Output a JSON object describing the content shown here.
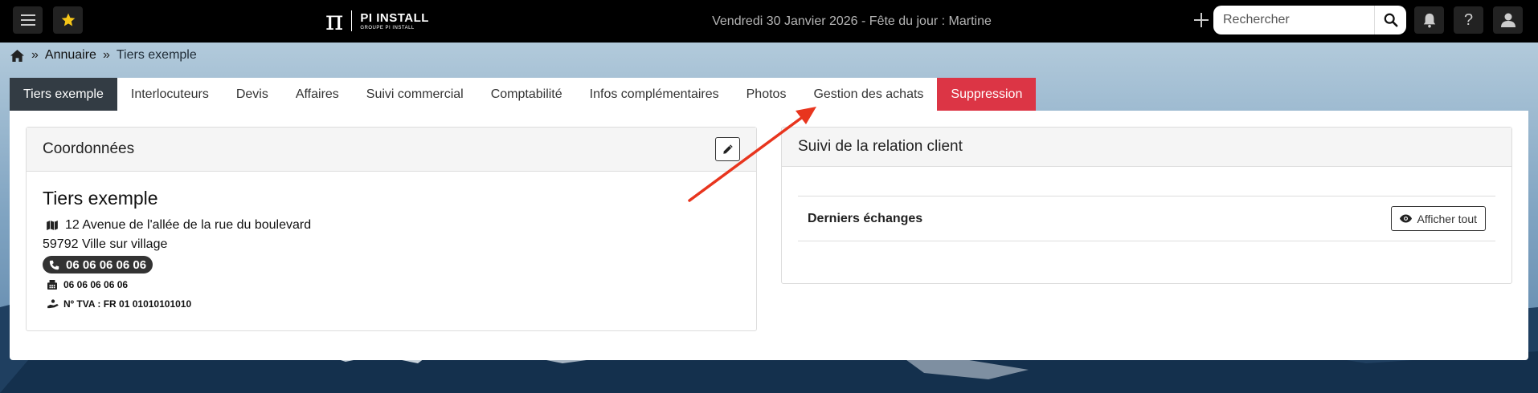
{
  "topbar": {
    "menu_icon": "hamburger-icon",
    "favorite_icon": "star-icon",
    "logo": {
      "symbol": "π",
      "name": "PI INSTALL",
      "tagline": "GROUPE PI INSTALL"
    },
    "date_text": "Vendredi 30 Janvier 2026 - Fête du jour : Martine",
    "search": {
      "placeholder": "Rechercher",
      "value": ""
    },
    "icons": [
      "plus-icon",
      "search-icon",
      "bell-icon",
      "help-icon",
      "user-icon"
    ],
    "help_glyph": "?"
  },
  "breadcrumb": {
    "home_icon": "home-icon",
    "separator": "»",
    "items": [
      "Annuaire",
      "Tiers exemple"
    ]
  },
  "tabs": [
    {
      "label": "Tiers exemple",
      "state": "active"
    },
    {
      "label": "Interlocuteurs"
    },
    {
      "label": "Devis"
    },
    {
      "label": "Affaires"
    },
    {
      "label": "Suivi commercial"
    },
    {
      "label": "Comptabilité"
    },
    {
      "label": "Infos complémentaires"
    },
    {
      "label": "Photos"
    },
    {
      "label": "Gestion des achats"
    },
    {
      "label": "Suppression",
      "state": "danger"
    }
  ],
  "coordonnees": {
    "header": "Coordonnées",
    "name": "Tiers exemple",
    "address_line1": "12 Avenue de l'allée de la rue du boulevard",
    "address_line2": "59792 Ville sur village",
    "phone": "06 06 06 06 06",
    "fax": "06 06 06 06 06",
    "vat": "Nº TVA : FR 01 01010101010"
  },
  "crm": {
    "header": "Suivi de la relation client",
    "section_title": "Derniers échanges",
    "show_all_label": "Afficher tout"
  },
  "colors": {
    "topbar_bg": "#000000",
    "active_tab": "#333c44",
    "danger_tab": "#dc3545",
    "annotation_arrow": "#e8351e"
  }
}
